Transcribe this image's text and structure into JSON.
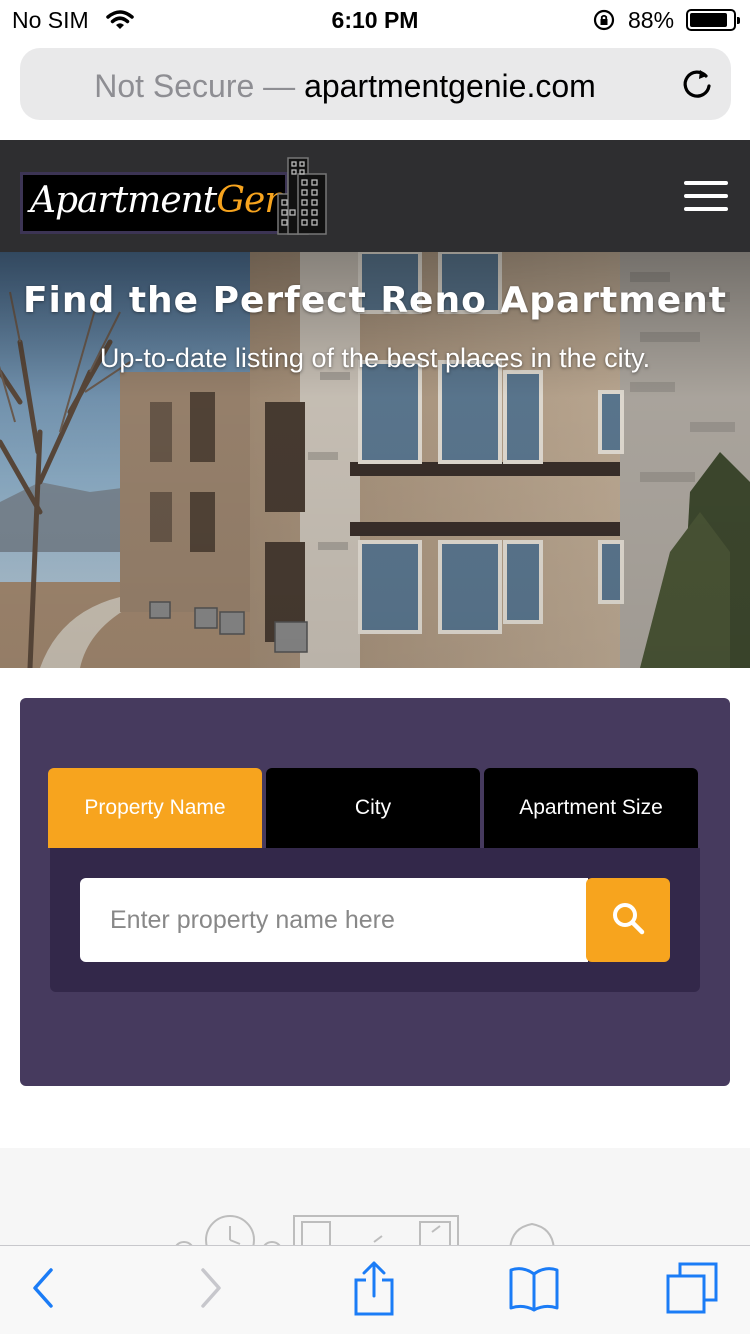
{
  "status_bar": {
    "carrier": "No SIM",
    "time": "6:10 PM",
    "battery": "88%",
    "battery_level": 0.88
  },
  "browser": {
    "security_label": "Not Secure —",
    "domain": "apartmentgenie.com"
  },
  "header": {
    "logo_text_a": "Apartment",
    "logo_text_b": "Genie"
  },
  "hero": {
    "title": "Find the Perfect Reno Apartment",
    "subtitle": "Up-to-date listing of the best places in the city."
  },
  "search": {
    "tabs": [
      {
        "label": "Property Name",
        "active": true
      },
      {
        "label": "City",
        "active": false
      },
      {
        "label": "Apartment Size",
        "active": false
      }
    ],
    "placeholder": "Enter property name here"
  },
  "colors": {
    "accent": "#f7a41e",
    "panel": "#463a5e",
    "panel_inner": "#33284a",
    "header_bg": "#2e2e30",
    "ios_blue": "#1b7cf6"
  },
  "icons": {
    "toolbar": [
      "back-icon",
      "forward-icon",
      "share-icon",
      "bookmarks-icon",
      "tabs-icon"
    ]
  }
}
